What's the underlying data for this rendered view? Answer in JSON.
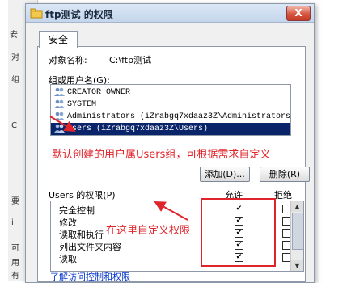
{
  "dialog": {
    "title": "ftp测试 的权限",
    "close_label": "X",
    "tab": "安全"
  },
  "object": {
    "label": "对象名称:",
    "value": "C:\\ftp测试"
  },
  "groups": {
    "label": "组或用户名(G):",
    "items": [
      {
        "name": "CREATOR OWNER",
        "selected": false
      },
      {
        "name": "SYSTEM",
        "selected": false
      },
      {
        "name": "Administrators (iZrabgq7xdaaz3Z\\Administrators)",
        "selected": false
      },
      {
        "name": "Users (iZrabgq7xdaaz3Z\\Users)",
        "selected": true
      }
    ]
  },
  "buttons": {
    "add": "添加(D)...",
    "remove": "删除(R)"
  },
  "permissions": {
    "label": "Users 的权限(P)",
    "allow_header": "允许",
    "deny_header": "拒绝",
    "items": [
      {
        "name": "完全控制",
        "allow": true,
        "deny": false
      },
      {
        "name": "修改",
        "allow": true,
        "deny": false
      },
      {
        "name": "读取和执行",
        "allow": true,
        "deny": false
      },
      {
        "name": "列出文件夹内容",
        "allow": true,
        "deny": false
      },
      {
        "name": "读取",
        "allow": true,
        "deny": false
      }
    ]
  },
  "link": "了解访问控制和权限",
  "annotations": {
    "users_note": "默认创建的用户属Users组，可根据需求自定义",
    "custom_note": "在这里自定义权限"
  },
  "background_fragments": [
    "安",
    "对",
    "组",
    "C",
    "要",
    "i",
    "可",
    "用",
    "有"
  ],
  "colors": {
    "annotation_red": "#e0242b",
    "selection_blue": "#0a246a",
    "link_blue": "#0033cc"
  }
}
